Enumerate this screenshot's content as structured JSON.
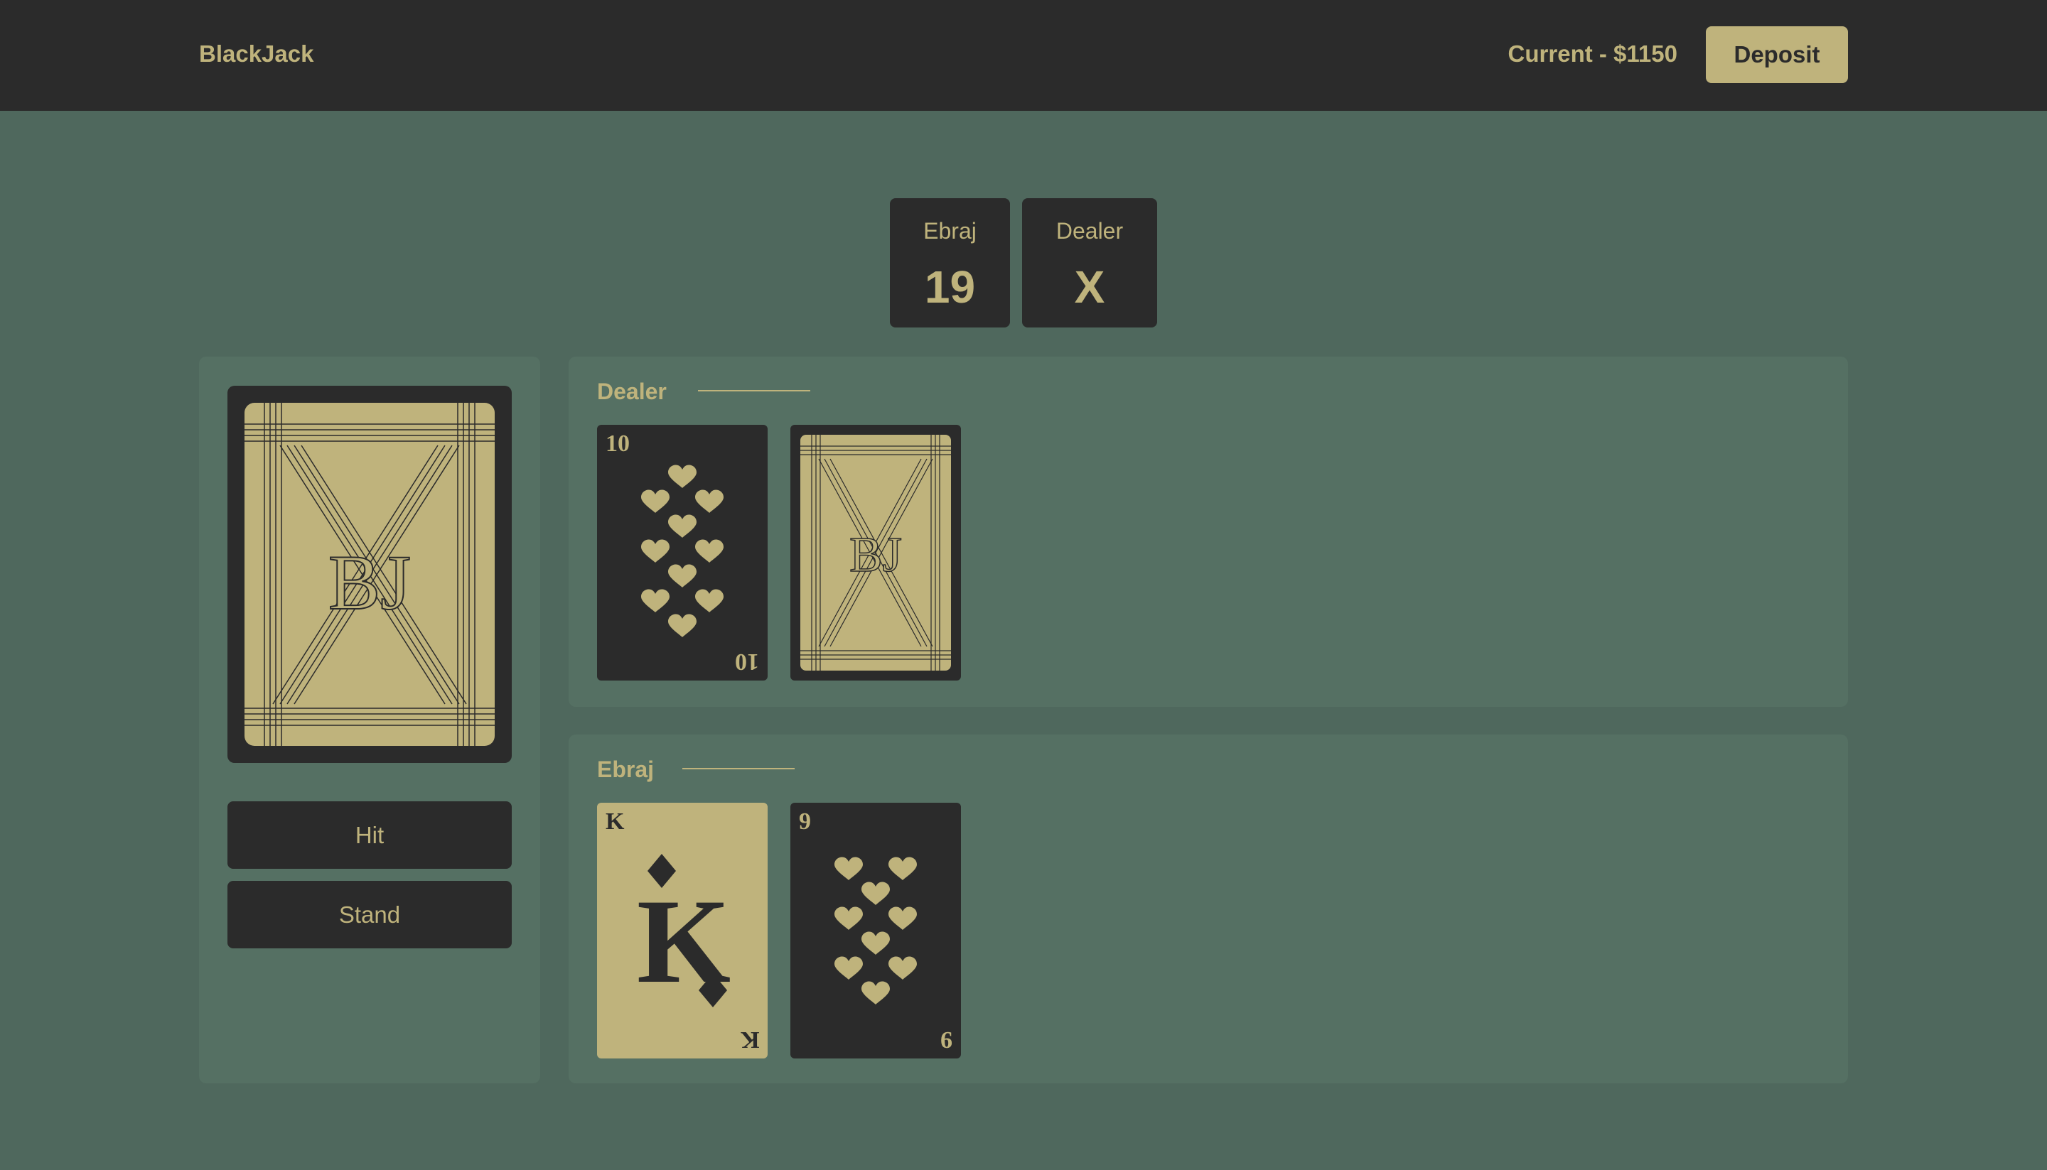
{
  "header": {
    "brand": "BlackJack",
    "balance": "Current - $1150",
    "deposit_label": "Deposit"
  },
  "scores": [
    {
      "name": "Ebraj",
      "value": "19"
    },
    {
      "name": "Dealer",
      "value": "X"
    }
  ],
  "deck": {
    "monogram": "BJ",
    "icon": "card-back-icon"
  },
  "actions": {
    "hit_label": "Hit",
    "stand_label": "Stand"
  },
  "dealer_hand": {
    "title": "Dealer",
    "cards": [
      {
        "rank": "10",
        "suit": "hearts",
        "face": "up"
      },
      {
        "face": "down",
        "monogram": "BJ"
      }
    ]
  },
  "player_hand": {
    "title": "Ebraj",
    "cards": [
      {
        "rank": "K",
        "suit": "diamonds",
        "face": "up"
      },
      {
        "rank": "9",
        "suit": "hearts",
        "face": "up"
      }
    ]
  },
  "colors": {
    "table": "#4f685d",
    "panel": "#557063",
    "dark": "#2b2b2b",
    "gold": "#bfb37c"
  }
}
